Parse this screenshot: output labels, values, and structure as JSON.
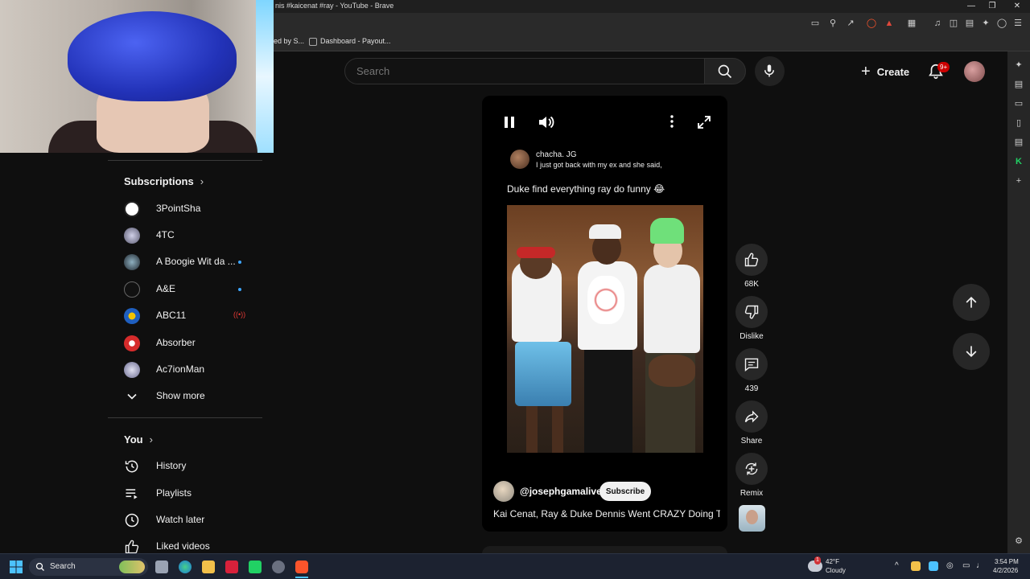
{
  "window": {
    "title": "nis #kaicenat #ray - YouTube - Brave"
  },
  "bookmarks": [
    {
      "label": "ed by S..."
    },
    {
      "label": "Dashboard - Payout..."
    }
  ],
  "masthead": {
    "search_placeholder": "Search",
    "create_label": "Create",
    "notification_count": "9+"
  },
  "guide": {
    "subscriptions_title": "Subscriptions",
    "subscriptions": [
      {
        "label": "3PointSha",
        "new": false,
        "live": false
      },
      {
        "label": "4TC",
        "new": false,
        "live": false
      },
      {
        "label": "A Boogie Wit da ...",
        "new": true,
        "live": false
      },
      {
        "label": "A&E",
        "new": true,
        "live": false
      },
      {
        "label": "ABC11",
        "new": false,
        "live": true
      },
      {
        "label": "Absorber",
        "new": false,
        "live": false
      },
      {
        "label": "Ac7ionMan",
        "new": false,
        "live": false
      }
    ],
    "show_more": "Show more",
    "you_title": "You",
    "you_items": [
      {
        "label": "History",
        "icon": "history-icon"
      },
      {
        "label": "Playlists",
        "icon": "playlists-icon"
      },
      {
        "label": "Watch later",
        "icon": "watch-later-icon"
      },
      {
        "label": "Liked videos",
        "icon": "liked-videos-icon"
      }
    ]
  },
  "short": {
    "overlay_user": "chacha. JG",
    "overlay_text": "I just got back with my ex and she said,",
    "caption": "Duke find everything ray do funny 😂",
    "channel": "@josephgamalive",
    "subscribe_label": "Subscribe",
    "video_title": "Kai Cenat, Ray & Duke Dennis Went CRAZY Doing Th..."
  },
  "actions": {
    "likes": "68K",
    "dislike_label": "Dislike",
    "comments": "439",
    "share_label": "Share",
    "remix_label": "Remix"
  },
  "taskbar": {
    "search_label": "Search",
    "weather_temp": "42°F",
    "weather_desc": "Cloudy",
    "time": "3:54 PM",
    "date": "4/2/2026",
    "weather_alert": "1"
  },
  "colors": {
    "background": "#0f0f0f",
    "accent_red": "#cc0000",
    "new_dot": "#3ea6ff",
    "live_red": "#e53935"
  }
}
